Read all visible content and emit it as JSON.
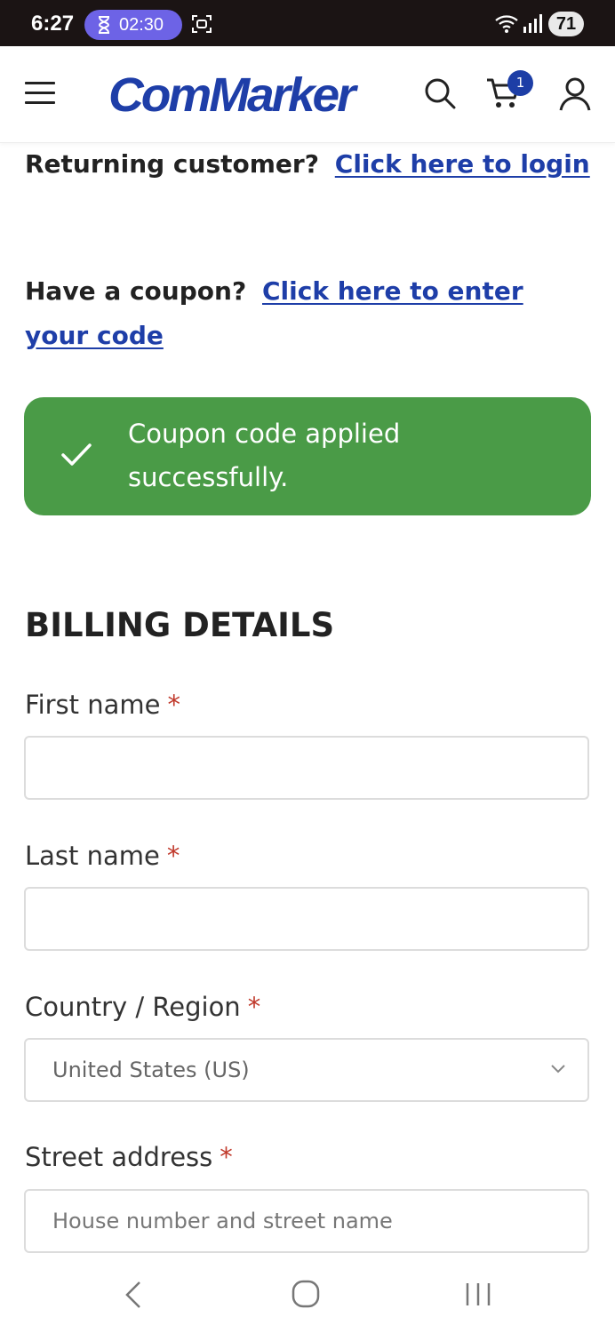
{
  "status_bar": {
    "time": "6:27",
    "timer": "02:30",
    "battery": "71"
  },
  "header": {
    "logo": "ComMarker",
    "cart_count": "1",
    "brand_color": "#1e3ea8"
  },
  "returning": {
    "text": "Returning customer?",
    "link": "Click here to login"
  },
  "coupon": {
    "text": "Have a coupon?",
    "link": "Click here to enter your code"
  },
  "notice": {
    "message": "Coupon code applied successfully.",
    "color": "#4a9b47"
  },
  "billing": {
    "title": "BILLING DETAILS",
    "required_mark": "*",
    "first_name": {
      "label": "First name",
      "value": ""
    },
    "last_name": {
      "label": "Last name",
      "value": ""
    },
    "country": {
      "label": "Country / Region",
      "value": "United States (US)"
    },
    "street": {
      "label": "Street address",
      "placeholder": "House number and street name"
    }
  }
}
